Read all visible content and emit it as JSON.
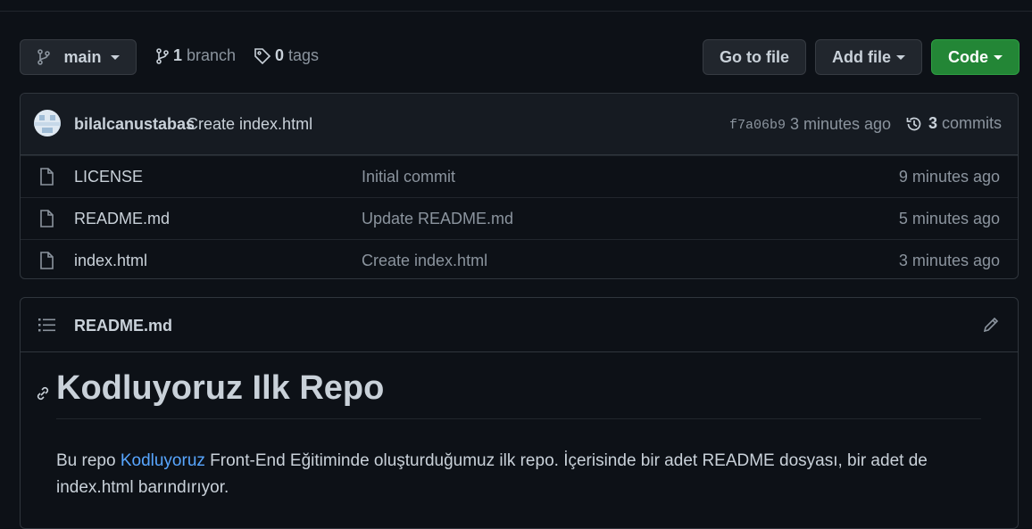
{
  "toolbar": {
    "branch_name": "main",
    "branch_count": "1",
    "branch_label": "branch",
    "tag_count": "0",
    "tag_label": "tags",
    "go_to_file": "Go to file",
    "add_file": "Add file",
    "code": "Code"
  },
  "latest_commit": {
    "author": "bilalcanustabas",
    "message": "Create index.html",
    "hash": "f7a06b9",
    "time": "3 minutes ago",
    "commit_count": "3",
    "commits_label": "commits"
  },
  "files": [
    {
      "name": "LICENSE",
      "message": "Initial commit",
      "time": "9 minutes ago"
    },
    {
      "name": "README.md",
      "message": "Update README.md",
      "time": "5 minutes ago"
    },
    {
      "name": "index.html",
      "message": "Create index.html",
      "time": "3 minutes ago"
    }
  ],
  "readme": {
    "filename": "README.md",
    "title": "Kodluyoruz Ilk Repo",
    "para_before": "Bu repo ",
    "para_link": "Kodluyoruz",
    "para_after": " Front-End Eğitiminde oluşturduğumuz ilk repo. İçerisinde bir adet README dosyası, bir adet de index.html barındırıyor."
  },
  "colors": {
    "background": "#0d1117",
    "code_button": "#238636",
    "link": "#58a6ff"
  }
}
